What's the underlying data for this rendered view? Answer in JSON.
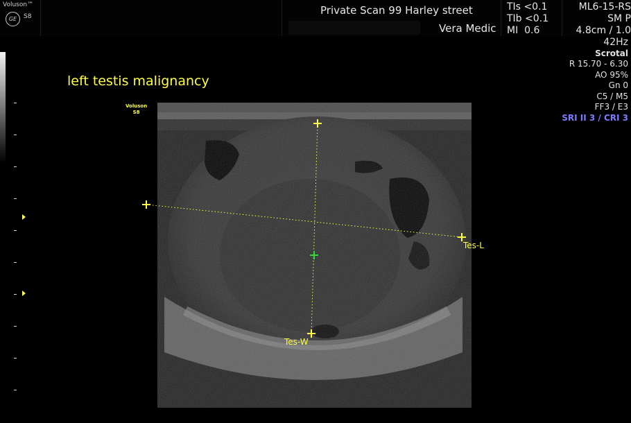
{
  "header": {
    "brand": "Voluson™",
    "logo_initials": "GE",
    "model": "S8",
    "hospital": "Private Scan 99 Harley street",
    "operator": "Vera Medic",
    "indices": [
      {
        "name": "TIs",
        "value": "<0.1"
      },
      {
        "name": "TIb",
        "value": "<0.1"
      },
      {
        "name": "MI",
        "value": "0.6"
      }
    ],
    "probe": "ML6-15-RS",
    "preset": "SM P",
    "depth": "4.8cm / 1.0"
  },
  "params": {
    "frame_rate": "42Hz",
    "mode": "Scrotal",
    "range": "R 15.70 - 6.30",
    "ao": "AO 95%",
    "gain": "Gn  0",
    "c_m": "C5 / M5",
    "ff_e": "FF3 / E3",
    "sri": "SRI II 3 / CRI 3"
  },
  "image": {
    "annotation": "left testis malignancy",
    "mini_brand": "Voluson",
    "mini_model": "S8"
  },
  "measurements": [
    {
      "label": "Tes-L"
    },
    {
      "label": "Tes-W"
    }
  ],
  "colors": {
    "annotation": "#ffff40",
    "caliper": "#ffff40",
    "center_marker": "#33dd33",
    "sri_text": "#7c7cff"
  }
}
